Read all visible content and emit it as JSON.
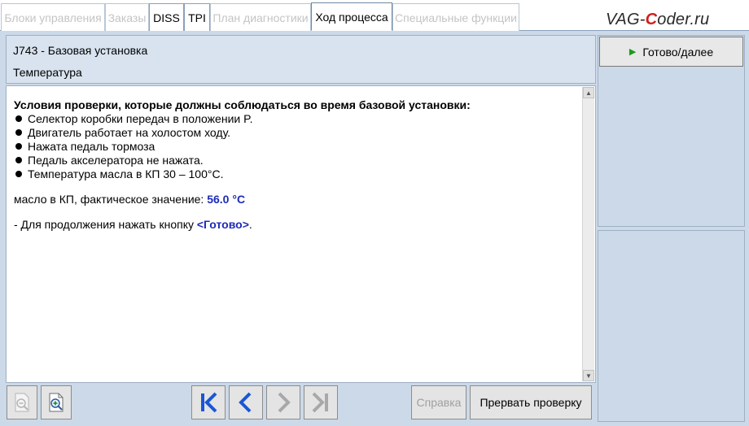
{
  "tabs": [
    {
      "label": "Блоки управления",
      "state": "disabled"
    },
    {
      "label": "Заказы",
      "state": "disabled"
    },
    {
      "label": "DISS",
      "state": "enabled"
    },
    {
      "label": "TPI",
      "state": "enabled"
    },
    {
      "label": "План диагностики",
      "state": "disabled"
    },
    {
      "label": "Ход процесса",
      "state": "active"
    },
    {
      "label": "Специальные функции",
      "state": "disabled"
    }
  ],
  "logo": {
    "prefix": "VAG-",
    "accent": "C",
    "suffix": "oder.ru",
    "accent_color": "#d41c1c"
  },
  "header": {
    "title": "J743 - Базовая установка",
    "subtitle": "Температура"
  },
  "content": {
    "heading": "Условия проверки, которые должны соблюдаться во время базовой установки:",
    "conditions": [
      "Селектор коробки передач в положении P.",
      "Двигатель работает на холостом ходу.",
      "Нажата педаль тормоза",
      "Педаль акселератора не нажата.",
      "Температура масла в КП 30 – 100°C."
    ],
    "measure_label": "масло в КП, фактическое значение: ",
    "measure_value": "56.0 °C",
    "continue_prefix": "- Для продолжения нажать кнопку ",
    "continue_button": "<Готово>",
    "continue_suffix": "."
  },
  "right_panel": {
    "ready_button_label": "Готово/далее"
  },
  "toolbar": {
    "zoom_out_icon": "zoom-out-icon",
    "zoom_in_icon": "zoom-in-icon",
    "first_icon": "first-page-icon",
    "prev_icon": "previous-icon",
    "next_icon": "next-icon",
    "last_icon": "last-page-icon",
    "help_label": "Справка",
    "abort_label": "Прервать проверку"
  },
  "colors": {
    "accent_blue": "#1c2bb8",
    "nav_blue": "#1a56d6",
    "play_green": "#1f9a1f",
    "panel_bg": "#ccd9e8"
  }
}
